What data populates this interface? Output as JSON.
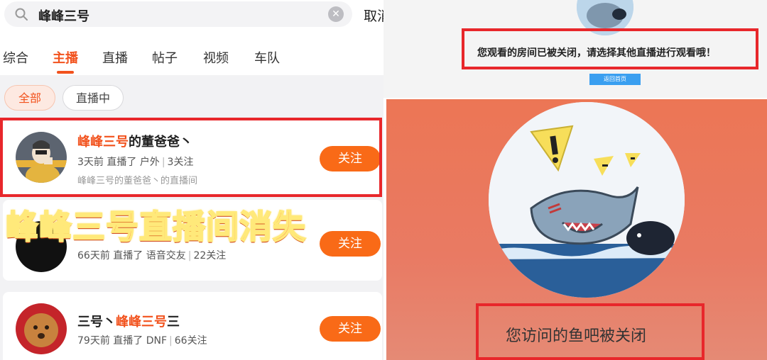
{
  "search": {
    "query": "峰峰三号",
    "cancel_label": "取消"
  },
  "tabs": [
    {
      "label": "综合"
    },
    {
      "label": "主播"
    },
    {
      "label": "直播"
    },
    {
      "label": "帖子"
    },
    {
      "label": "视频"
    },
    {
      "label": "车队"
    }
  ],
  "active_tab": "主播",
  "filters": [
    {
      "label": "全部"
    },
    {
      "label": "直播中"
    }
  ],
  "results": [
    {
      "name_highlight": "峰峰三号",
      "name_rest": "的董爸爸丶",
      "time": "3天前 直播了",
      "category": "户外",
      "followers": "3关注",
      "description": "峰峰三号的董爸爸丶的直播间",
      "follow_label": "关注"
    },
    {
      "time": "66天前 直播了",
      "category": "语音交友",
      "followers": "22关注",
      "follow_label": "关注"
    },
    {
      "name_pre": "三号丶",
      "name_highlight": "峰峰三号",
      "name_post": "三",
      "time": "79天前 直播了",
      "category": "DNF",
      "followers": "66关注",
      "follow_label": "关注"
    }
  ],
  "overlay_caption": "峰峰三号直播间消失",
  "right_notice": "您观看的房间已被关闭，请选择其他直播进行观看哦！",
  "back_home_label": "返回首页",
  "closed_message": "您访问的鱼吧被关闭",
  "colors": {
    "accent": "#f2521d",
    "follow_button": "#f96a17",
    "frame_red": "#e8272b",
    "panel_bg": "#ec7655"
  }
}
